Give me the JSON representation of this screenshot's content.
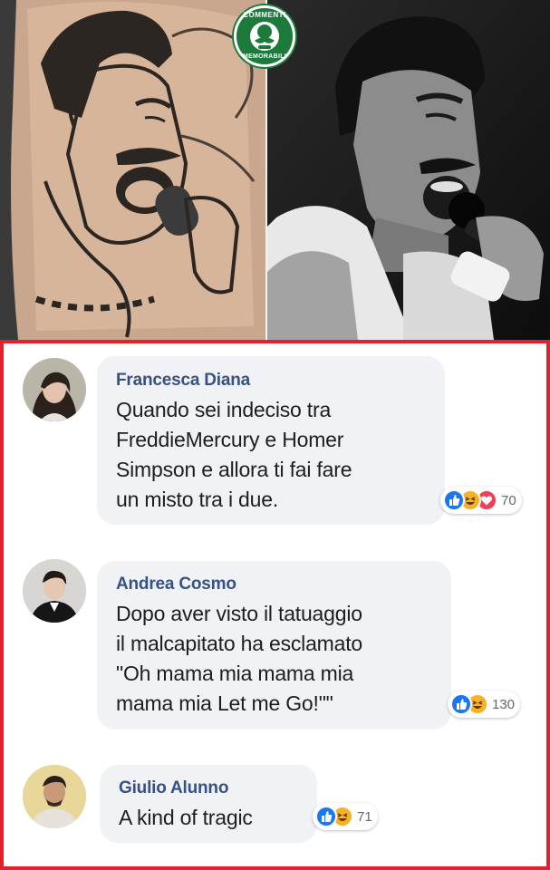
{
  "watermark": {
    "text_top": "COMMENTI",
    "text_bottom": "MEMORABILI",
    "icon": "mustache-face-icon"
  },
  "photos": {
    "left": {
      "description_icon": "tattoo-photo"
    },
    "right": {
      "description_icon": "singer-photo"
    }
  },
  "comments": [
    {
      "author": "Francesca Diana",
      "lines": [
        "Quando sei indeciso tra",
        "FreddieMercury e Homer",
        "Simpson e allora ti fai fare",
        "un misto tra i due."
      ],
      "reactions": [
        "like-icon",
        "haha-icon",
        "love-icon"
      ],
      "count": "70"
    },
    {
      "author": "Andrea Cosmo",
      "lines": [
        "Dopo aver visto il tatuaggio",
        "il malcapitato ha esclamato",
        "\"Oh mama mia mama mia",
        "mama mia Let me Go!\"\""
      ],
      "reactions": [
        "like-icon",
        "haha-icon"
      ],
      "count": "130"
    },
    {
      "author": "Giulio Alunno",
      "lines": [
        "A kind of tragic"
      ],
      "reactions": [
        "like-icon",
        "haha-icon"
      ],
      "count": "71"
    }
  ],
  "colors": {
    "frame": "#e4202c",
    "author": "#385185",
    "bubble": "#f0f2f5",
    "like": "#1877f2",
    "haha": "#f7b125",
    "love": "#f33e58",
    "badge": "#1c7a3a"
  }
}
